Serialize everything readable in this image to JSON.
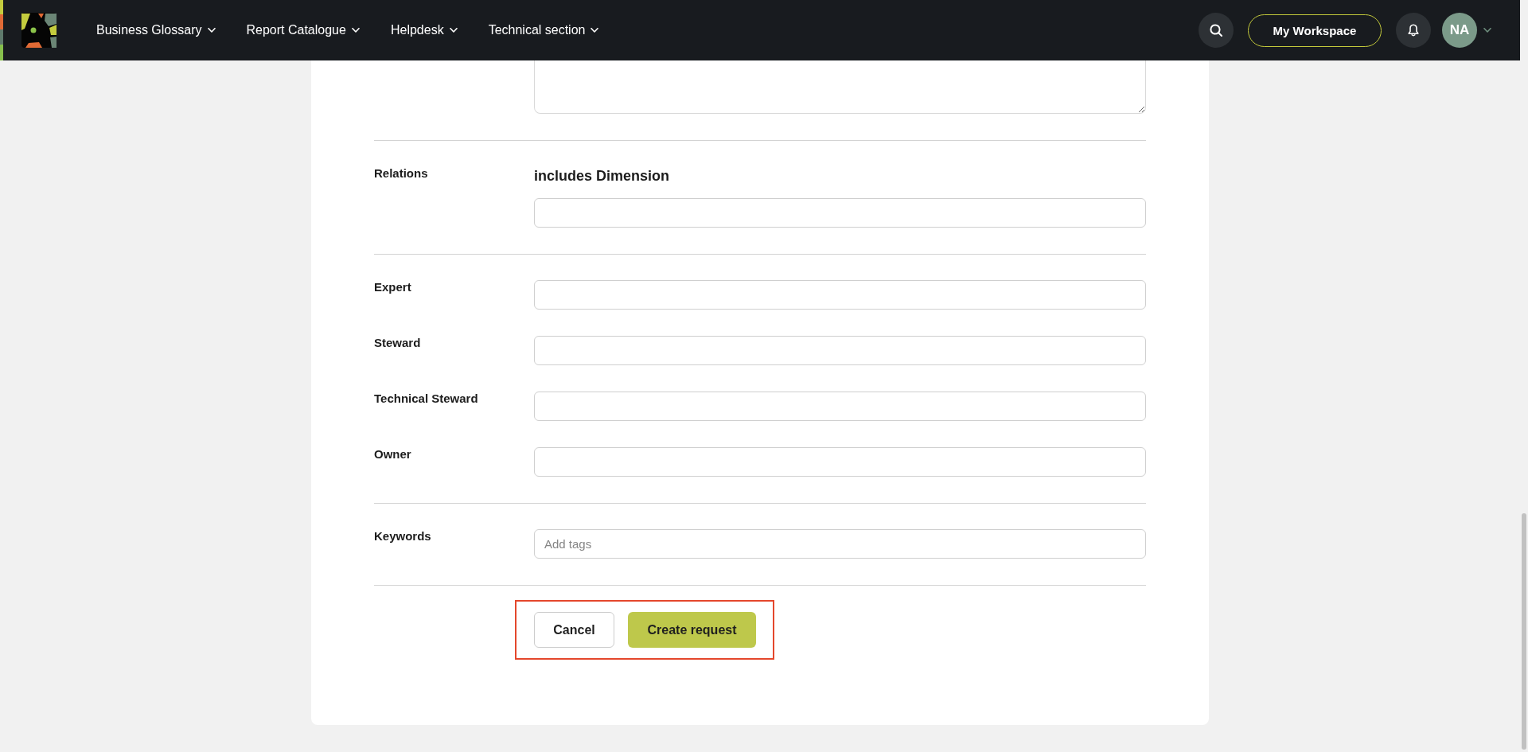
{
  "nav": {
    "menus": [
      {
        "label": "Business Glossary",
        "dropdown": true
      },
      {
        "label": "Report Catalogue",
        "dropdown": true
      },
      {
        "label": "Helpdesk",
        "dropdown": true
      },
      {
        "label": "Technical section",
        "dropdown": true
      }
    ]
  },
  "header": {
    "workspace_button": "My Workspace",
    "avatar": {
      "initials": "NA",
      "dropdown": true
    }
  },
  "form": {
    "sections": [
      {
        "kind": "textarea"
      },
      {
        "kind": "relation",
        "label": "Relations",
        "heading": "includes Dimension"
      },
      {
        "kind": "fields",
        "fields": [
          {
            "label": "Expert"
          },
          {
            "label": "Steward"
          },
          {
            "label": "Technical Steward"
          },
          {
            "label": "Owner"
          }
        ]
      },
      {
        "kind": "fields",
        "fields": [
          {
            "label": "Keywords",
            "placeholder": "Add tags"
          }
        ]
      },
      {
        "kind": "actions",
        "highlighted": true,
        "buttons": [
          {
            "label": "Cancel",
            "kind": "secondary"
          },
          {
            "label": "Create request",
            "kind": "primary"
          }
        ]
      }
    ]
  }
}
